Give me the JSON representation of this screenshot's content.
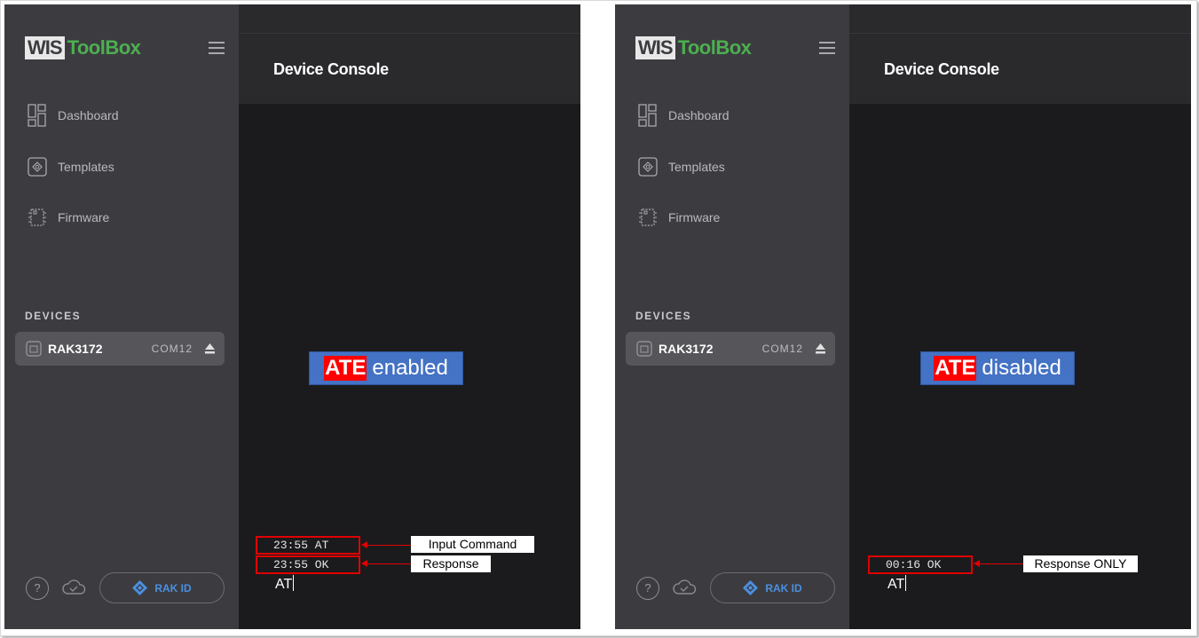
{
  "app": {
    "logo_wis": "WIS",
    "logo_toolbox": "ToolBox",
    "page_title": "Device Console"
  },
  "sidebar": {
    "nav": [
      {
        "label": "Dashboard",
        "icon": "dashboard-icon"
      },
      {
        "label": "Templates",
        "icon": "templates-icon"
      },
      {
        "label": "Firmware",
        "icon": "chip-icon"
      }
    ],
    "devices_label": "DEVICES",
    "device": {
      "name": "RAK3172",
      "port": "COM12",
      "icon": "device-icon"
    },
    "footer": {
      "help": "?",
      "rak_id": "RAK ID"
    }
  },
  "panels": {
    "left": {
      "ate_word": "ATE",
      "ate_state": "enabled",
      "lines": [
        {
          "text": "23:55  AT",
          "callout": "Input Command"
        },
        {
          "text": "23:55  OK",
          "callout": "Response"
        }
      ],
      "input": "AT"
    },
    "right": {
      "ate_word": "ATE",
      "ate_state": "disabled",
      "lines": [
        {
          "text": "00:16  OK",
          "callout": "Response ONLY"
        }
      ],
      "input": "AT"
    }
  },
  "colors": {
    "sidebar": "#3c3c40",
    "console": "#1b1b1d",
    "accent_green": "#4caf50",
    "accent_blue": "#4a90e2",
    "badge": "#4472c4",
    "annotation_red": "#e00000"
  }
}
